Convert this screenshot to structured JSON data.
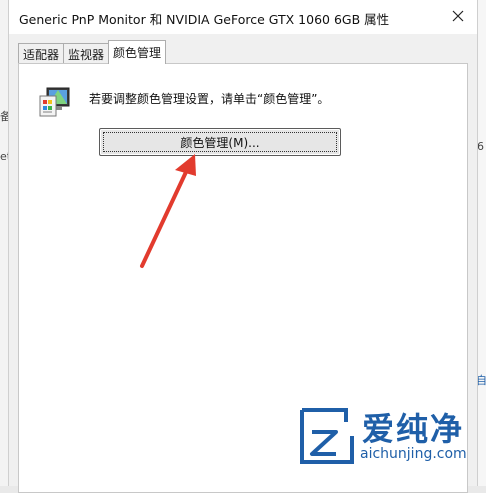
{
  "dialog": {
    "title": "Generic PnP Monitor 和 NVIDIA GeForce GTX 1060 6GB 属性",
    "close_glyph": "✕"
  },
  "tabs": [
    {
      "label": "适配器",
      "active": false
    },
    {
      "label": "监视器",
      "active": false
    },
    {
      "label": "颜色管理",
      "active": true
    }
  ],
  "color_management": {
    "description": "若要调整颜色管理设置，请单击“颜色管理”。",
    "button_label": "颜色管理(M)..."
  },
  "background_fragments": [
    "备",
    "et",
    "6",
    "自"
  ],
  "watermark": {
    "brand": "爱纯净",
    "url": "aichunjing.com"
  },
  "colors": {
    "annotation_arrow": "#e23b2e",
    "watermark": "#1f5fa8"
  }
}
